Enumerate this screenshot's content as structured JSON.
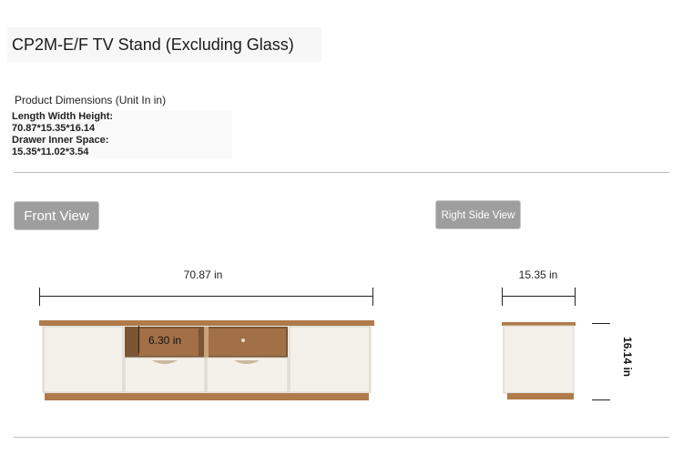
{
  "title": "CP2M-E/F TV Stand (Excluding Glass)",
  "dimensions": {
    "heading": "Product Dimensions (Unit In in)",
    "lwh_label": "Length Width Height:",
    "lwh_value": "70.87*15.35*16.14",
    "drawer_label": "Drawer Inner Space:",
    "drawer_value": "15.35*11.02*3.54"
  },
  "views": {
    "front_label": "Front View",
    "side_label": "Right Side View"
  },
  "measurements": {
    "front_width": "70.87 in",
    "compartment_height": "6.30 in",
    "side_depth": "15.35 in",
    "side_height": "16.14 in"
  },
  "colors": {
    "wood": "#b07a4a",
    "panel": "#f1eee8",
    "button_gray": "#9e9e9e",
    "divider": "#bdbdbd"
  }
}
